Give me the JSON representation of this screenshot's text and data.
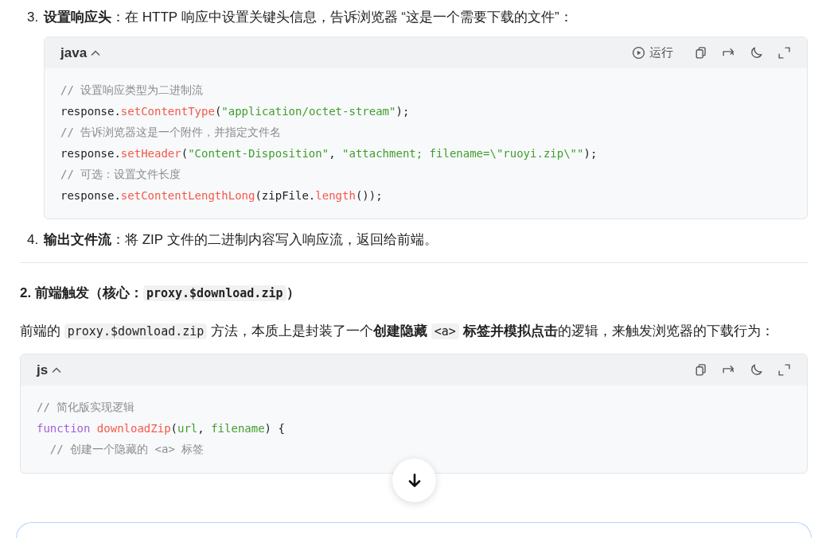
{
  "blocks": [
    {
      "kind": "list_item",
      "number": "3.",
      "segments": [
        {
          "kind": "bold",
          "text": "设置响应头"
        },
        {
          "kind": "text",
          "text": "：在 HTTP 响应中设置关键头信息，告诉浏览器 “这是一个需要下载的文件”："
        }
      ]
    },
    {
      "kind": "code",
      "indented": true,
      "language": "java",
      "expanded": true,
      "actions": [
        {
          "kind": "run",
          "label": "运行"
        },
        {
          "kind": "copy"
        },
        {
          "kind": "share"
        },
        {
          "kind": "theme"
        },
        {
          "kind": "fullscreen"
        }
      ],
      "lines": [
        [
          {
            "kind": "comment",
            "text": "// 设置响应类型为二进制流"
          }
        ],
        [
          {
            "kind": "plain",
            "text": "response."
          },
          {
            "kind": "method",
            "text": "setContentType"
          },
          {
            "kind": "plain",
            "text": "("
          },
          {
            "kind": "string",
            "text": "\"application/octet-stream\""
          },
          {
            "kind": "plain",
            "text": ");"
          }
        ],
        [
          {
            "kind": "comment",
            "text": "// 告诉浏览器这是一个附件，并指定文件名"
          }
        ],
        [
          {
            "kind": "plain",
            "text": "response."
          },
          {
            "kind": "method",
            "text": "setHeader"
          },
          {
            "kind": "plain",
            "text": "("
          },
          {
            "kind": "string",
            "text": "\"Content-Disposition\""
          },
          {
            "kind": "plain",
            "text": ", "
          },
          {
            "kind": "string",
            "text": "\"attachment; filename=\\\"ruoyi.zip\\\"\""
          },
          {
            "kind": "plain",
            "text": ");"
          }
        ],
        [
          {
            "kind": "comment",
            "text": "// 可选：设置文件长度"
          }
        ],
        [
          {
            "kind": "plain",
            "text": "response."
          },
          {
            "kind": "method",
            "text": "setContentLengthLong"
          },
          {
            "kind": "plain",
            "text": "(zipFile."
          },
          {
            "kind": "method",
            "text": "length"
          },
          {
            "kind": "plain",
            "text": "());"
          }
        ]
      ]
    },
    {
      "kind": "list_item",
      "number": "4.",
      "segments": [
        {
          "kind": "bold",
          "text": "输出文件流"
        },
        {
          "kind": "text",
          "text": "：将 ZIP 文件的二进制内容写入响应流，返回给前端。"
        }
      ]
    },
    {
      "kind": "divider"
    },
    {
      "kind": "heading",
      "segments": [
        {
          "kind": "text",
          "text": "2. 前端触发（核心："
        },
        {
          "kind": "code",
          "text": "proxy.$download.zip"
        },
        {
          "kind": "text",
          "text": "）"
        }
      ]
    },
    {
      "kind": "paragraph",
      "segments": [
        {
          "kind": "text",
          "text": "前端的 "
        },
        {
          "kind": "code",
          "text": "proxy.$download.zip"
        },
        {
          "kind": "text",
          "text": " 方法，本质上是封装了一个"
        },
        {
          "kind": "bold",
          "text": "创建隐藏 "
        },
        {
          "kind": "code",
          "text": "<a>"
        },
        {
          "kind": "bold",
          "text": " 标签并模拟点击"
        },
        {
          "kind": "text",
          "text": "的逻辑，来触发浏览器的下载行为："
        }
      ]
    },
    {
      "kind": "code",
      "indented": false,
      "language": "js",
      "expanded": true,
      "actions": [
        {
          "kind": "copy"
        },
        {
          "kind": "share"
        },
        {
          "kind": "theme"
        },
        {
          "kind": "fullscreen"
        }
      ],
      "lines": [
        [
          {
            "kind": "comment",
            "text": "// 简化版实现逻辑"
          }
        ],
        [
          {
            "kind": "keyword",
            "text": "function "
          },
          {
            "kind": "method",
            "text": "downloadZip"
          },
          {
            "kind": "plain",
            "text": "("
          },
          {
            "kind": "param",
            "text": "url"
          },
          {
            "kind": "plain",
            "text": ", "
          },
          {
            "kind": "param",
            "text": "filename"
          },
          {
            "kind": "plain",
            "text": ") {"
          }
        ],
        [
          {
            "kind": "comment",
            "text": "  // 创建一个隐藏的 <a> 标签"
          }
        ]
      ]
    }
  ],
  "scroll_down_button": {
    "kind": "arrow"
  },
  "chat_input": {
    "kind": "field"
  }
}
